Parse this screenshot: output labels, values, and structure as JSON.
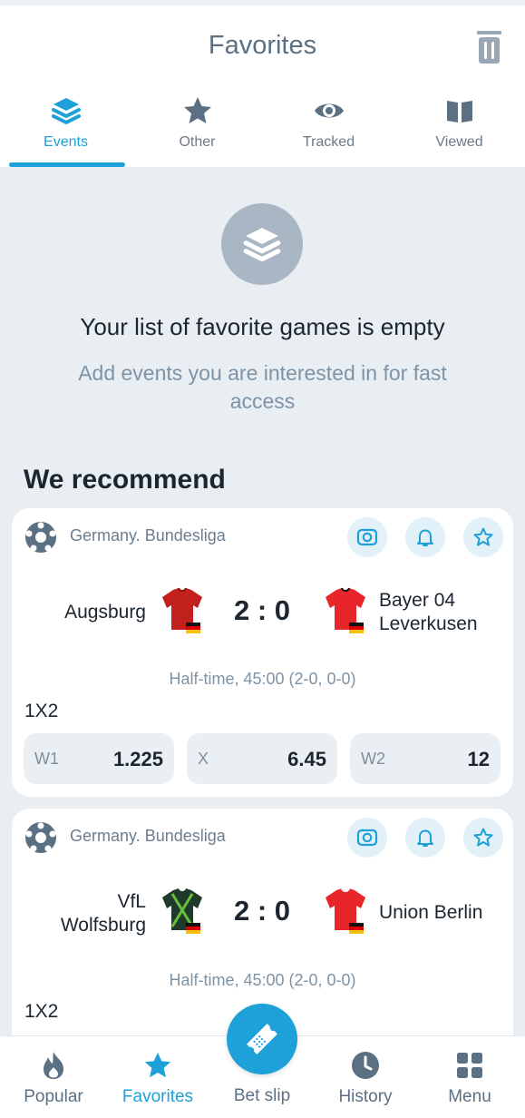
{
  "header": {
    "title": "Favorites"
  },
  "tabs": [
    {
      "label": "Events",
      "icon": "layers-icon",
      "active": true
    },
    {
      "label": "Other",
      "icon": "star-icon"
    },
    {
      "label": "Tracked",
      "icon": "eye-icon"
    },
    {
      "label": "Viewed",
      "icon": "book-icon"
    }
  ],
  "empty": {
    "title": "Your list of favorite games is empty",
    "subtitle": "Add events you are interested in for fast access"
  },
  "recommend": {
    "title": "We recommend",
    "matches": [
      {
        "league": "Germany. Bundesliga",
        "team1": "Augsburg",
        "team2": "Bayer 04 Leverkusen",
        "score": "2 : 0",
        "status": "Half-time, 45:00 (2-0, 0-0)",
        "market": "1X2",
        "odds": [
          {
            "label": "W1",
            "value": "1.225"
          },
          {
            "label": "X",
            "value": "6.45"
          },
          {
            "label": "W2",
            "value": "12"
          }
        ]
      },
      {
        "league": "Germany. Bundesliga",
        "team1": "VfL Wolfsburg",
        "team2": "Union Berlin",
        "score": "2 : 0",
        "status": "Half-time, 45:00 (2-0, 0-0)",
        "market": "1X2"
      }
    ]
  },
  "nav": {
    "popular": "Popular",
    "favorites": "Favorites",
    "betslip": "Bet slip",
    "history": "History",
    "menu": "Menu"
  },
  "colors": {
    "accent": "#1ea0d8",
    "muted": "#7d93a6",
    "background": "#e9eef3"
  }
}
